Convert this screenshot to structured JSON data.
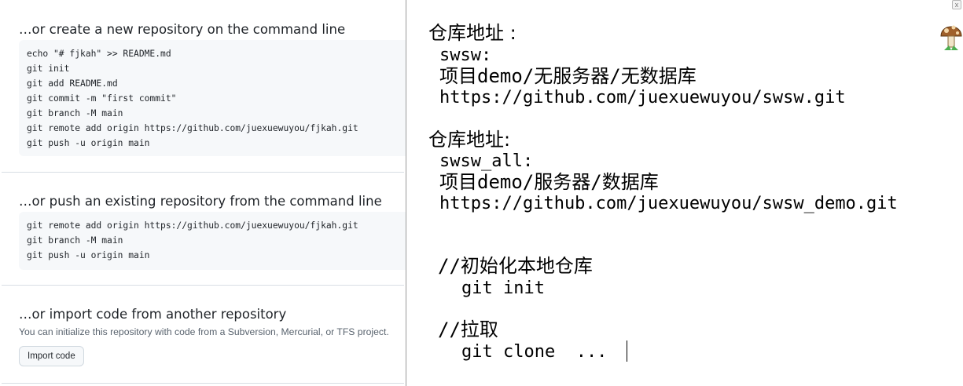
{
  "github": {
    "new_repo": {
      "heading": "…or create a new repository on the command line",
      "lines": [
        "echo \"# fjkah\" >> README.md",
        "git init",
        "git add README.md",
        "git commit -m \"first commit\"",
        "git branch -M main",
        "git remote add origin https://github.com/juexuewuyou/fjkah.git",
        "git push -u origin main"
      ]
    },
    "push_existing": {
      "heading": "…or push an existing repository from the command line",
      "lines": [
        "git remote add origin https://github.com/juexuewuyou/fjkah.git",
        "git branch -M main",
        "git push -u origin main"
      ]
    },
    "import": {
      "heading": "…or import code from another repository",
      "description": "You can initialize this repository with code from a Subversion, Mercurial, or TFS project.",
      "button_label": "Import code"
    }
  },
  "notes": {
    "block1": {
      "heading": "仓库地址 :",
      "name": "swsw:",
      "path": "项目demo/无服务器/无数据库",
      "url": "https://github.com/juexuewuyou/swsw.git"
    },
    "block2": {
      "heading": "仓库地址:",
      "name": "swsw_all:",
      "path": "项目demo/服务器/数据库",
      "url": "https://github.com/juexuewuyou/swsw_demo.git"
    },
    "init_comment": "//初始化本地仓库",
    "init_cmd": "git init",
    "clone_comment": "//拉取",
    "clone_cmd": "git clone  ..."
  },
  "widget": {
    "close_glyph": "x",
    "icon": "mushroom-icon"
  }
}
